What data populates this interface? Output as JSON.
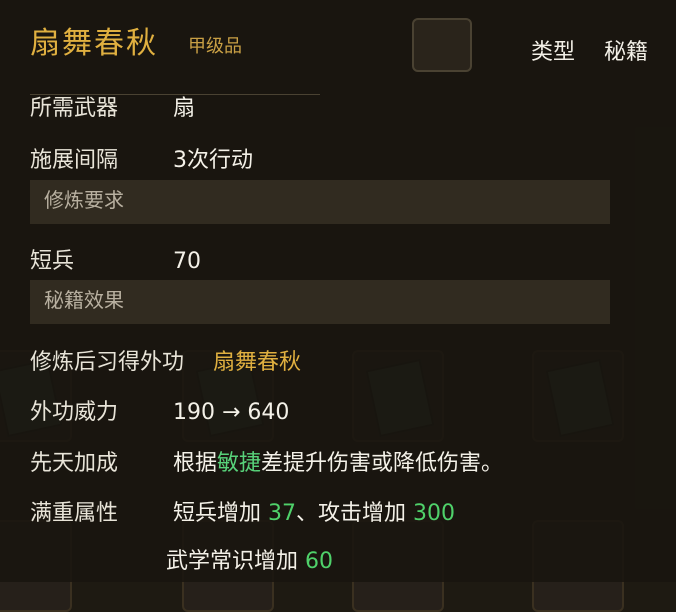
{
  "skill": {
    "name": "扇舞春秋",
    "grade": "甲级品",
    "type_label": "类型",
    "type_value": "秘籍"
  },
  "attributes": [
    {
      "label": "所需武器",
      "value": "扇"
    },
    {
      "label": "施展间隔",
      "value": "3次行动"
    }
  ],
  "requirements": {
    "header": "修炼要求",
    "items": [
      {
        "label": "短兵",
        "value": "70"
      }
    ]
  },
  "effects": {
    "header": "秘籍效果",
    "learn_label": "修炼后习得外功",
    "learn_value": "扇舞春秋",
    "power_label": "外功威力",
    "power_value": "190 → 640",
    "innate_label": "先天加成",
    "innate_pre": "根据",
    "innate_hl": "敏捷",
    "innate_post": "差提升伤害或降低伤害。",
    "max_label": "满重属性",
    "max_line1_a": "短兵增加 ",
    "max_line1_b": "37",
    "max_line1_c": "、攻击增加 ",
    "max_line1_d": "300",
    "max_line2_a": "武学常识增加 ",
    "max_line2_b": "60"
  },
  "colors": {
    "title": "#e0b040",
    "green": "#4fd16a",
    "panel": "#18150f"
  }
}
